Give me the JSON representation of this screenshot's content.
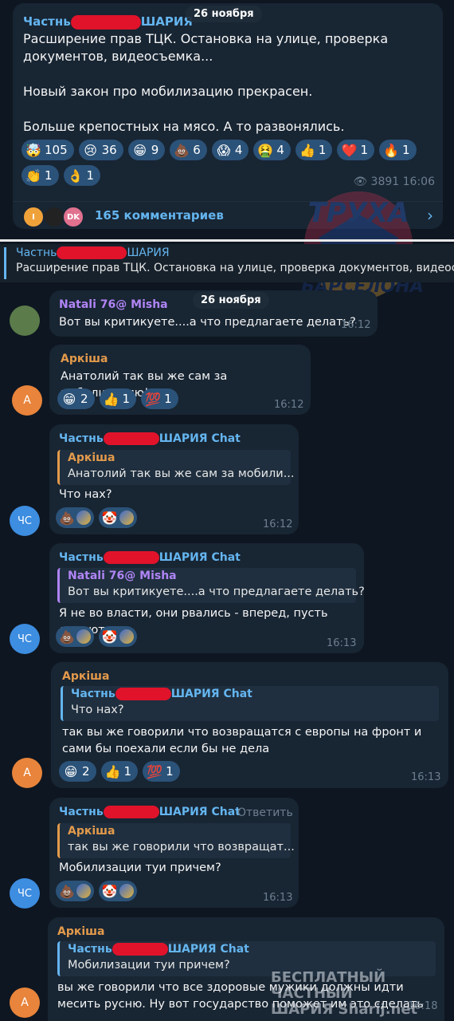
{
  "channel_post": {
    "author": "Частнь ШАРИЯ",
    "date_chip": "26 ноября",
    "text": "Расширение прав ТЦК. Остановка на улице, проверка документов, видеосъемка...\n\nНовый закон про мобилизацию прекрасен.\n\nБольше крепостных на мясо. А то развонялись.",
    "reactions": [
      {
        "emoji": "🤯",
        "count": "105"
      },
      {
        "emoji": "😢",
        "count": "36"
      },
      {
        "emoji": "😁",
        "count": "9"
      },
      {
        "emoji": "💩",
        "count": "6"
      },
      {
        "emoji": "😱",
        "count": "4"
      },
      {
        "emoji": "🤮",
        "count": "4"
      },
      {
        "emoji": "👍",
        "count": "1"
      },
      {
        "emoji": "❤️",
        "count": "1"
      },
      {
        "emoji": "🔥",
        "count": "1"
      },
      {
        "emoji": "👏",
        "count": "1"
      },
      {
        "emoji": "👌",
        "count": "1"
      }
    ],
    "views": "3891",
    "time": "16:06",
    "commenters": [
      "I",
      "",
      "DK"
    ],
    "comments_label": "165 комментариев"
  },
  "pinned": {
    "title": "Частнь ШАРИЯ",
    "text": "Расширение прав ТЦК. Остановка на улице, проверка документов, видеос..."
  },
  "date_chip_2": "26 ноября",
  "watermark_text": "ТРУХА\nБАРСЕЛОНА",
  "messages": [
    {
      "author": "Natali 76@ Misha",
      "text": "Вот вы критикуете....а что предлагаете делать?",
      "time": "16:12"
    },
    {
      "author": "Аркiша",
      "avatar": "A",
      "text": "Анатолий так вы же сам за мобилизацию!",
      "time": "16:12",
      "reactions": [
        {
          "emoji": "😁",
          "count": "2"
        },
        {
          "emoji": "👍",
          "count": "1"
        },
        {
          "emoji": "💯",
          "count": "1"
        }
      ]
    },
    {
      "author": "Частнь ШАРИЯ Chat",
      "avatar": "ЧС",
      "quote_author": "Аркiша",
      "quote_text": "Анатолий так вы же сам за мобили...",
      "text": "Что нах?",
      "time": "16:12"
    },
    {
      "author": "Частнь ШАРИЯ Chat",
      "avatar": "ЧС",
      "quote_author": "Natali 76@ Misha",
      "quote_text": "Вот вы критикуете....а что предлагаете делать?",
      "text": "Я не во власти, они рвались - вперед, пусть делают",
      "time": "16:13"
    },
    {
      "author": "Аркiша",
      "avatar": "A",
      "quote_author": "Частнь ШАРИЯ Chat",
      "quote_text": "Что нах?",
      "text": "так вы же говорили что возвращатся с европы на фронт и сами бы поехали если бы не дела",
      "time": "16:13",
      "reactions": [
        {
          "emoji": "😁",
          "count": "2"
        },
        {
          "emoji": "👍",
          "count": "1"
        },
        {
          "emoji": "💯",
          "count": "1"
        }
      ]
    },
    {
      "author": "Частнь ШАРИЯ Chat",
      "avatar": "ЧС",
      "reply_label": "Ответить",
      "quote_author": "Аркiша",
      "quote_text": "так вы же говорили что возвращат...",
      "text": "Мобилизации туи причем?",
      "time": "16:13"
    },
    {
      "author": "Аркiша",
      "avatar": "A",
      "quote_author": "Частнь ШАРИЯ Chat",
      "quote_text": "Мобилизации туи причем?",
      "text": "вы же говорили что все здоровые мужики должны идти месить русню. Ну вот государство поможет им это сделать",
      "time": "16:18"
    }
  ],
  "bottom_watermark": "БЕСПЛАТНЫЙ ЧАСТНЫЙ\nШАРИЯ Sharij.net",
  "colors": {
    "background": "#0e1621",
    "bubble": "#182533",
    "accent": "#64b5ef",
    "orange": "#e39a4b",
    "redaction": "#e0132b"
  }
}
